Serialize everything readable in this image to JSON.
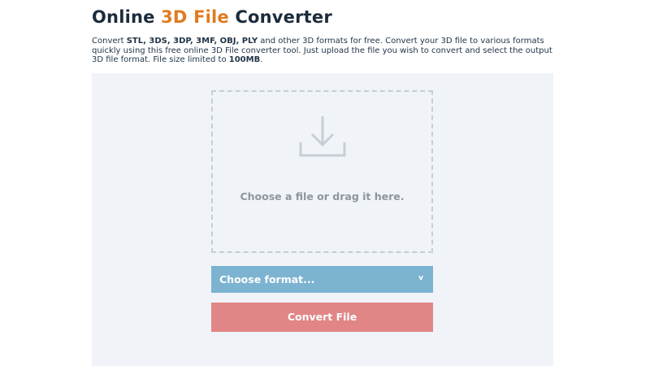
{
  "header": {
    "title_pre": "Online ",
    "title_accent": "3D File",
    "title_post": " Converter",
    "accent_color": "#e07b1f"
  },
  "description": {
    "p1": "Convert ",
    "formats": "STL, 3DS, 3DP, 3MF, OBJ, PLY",
    "p2": " and other 3D formats for free. Convert your 3D file to various formats quickly using this free online 3D File converter tool. Just upload the file you wish to convert and select the output 3D file format. File size limited to ",
    "limit": "100MB",
    "p3": "."
  },
  "dropzone": {
    "icon": "download-icon",
    "text": "Choose a file or drag it here."
  },
  "format_select": {
    "label": "Choose format...",
    "chevron": "v",
    "color": "#7cb3d1"
  },
  "convert_button": {
    "label": "Convert File",
    "color": "#e18586"
  }
}
